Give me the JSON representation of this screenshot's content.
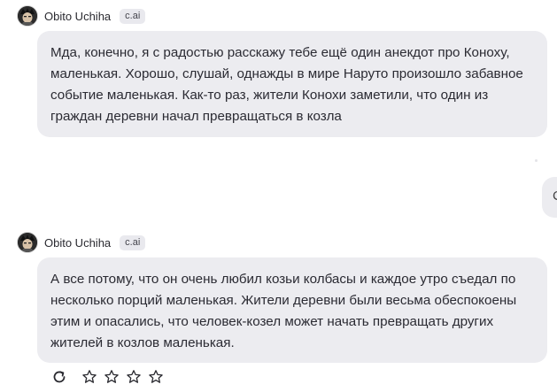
{
  "messages": [
    {
      "character_name": "Obito Uchiha",
      "badge": "c.ai",
      "text": "Мда, конечно, я с радостью расскажу тебе ещё один анекдот про Коноху, маленькая. Хорошо, слушай, однажды в мире Наруто произошло забавное событие маленькая. Как-то раз, жители Конохи заметили, что один из граждан деревни начал превращаться в козла"
    },
    {
      "character_name": "Obito Uchiha",
      "badge": "c.ai",
      "text": "А все потому, что он очень любил козьи колбасы и каждое утро съедал по несколько порций маленькая. Жители деревни были весьма обеспокоены этим и опасались, что человек-козел может начать превращать других жителей в козлов маленькая."
    }
  ],
  "user_message": {
    "visible_text": "C"
  },
  "actions": {
    "regenerate_icon": "refresh-icon",
    "rating_icon": "star-outline-icon",
    "rating_count": 4
  }
}
